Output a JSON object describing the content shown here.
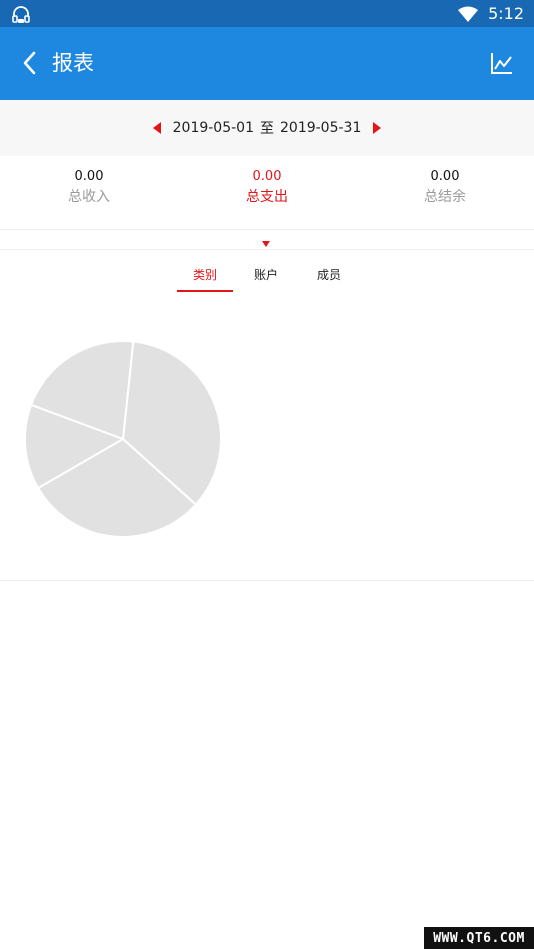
{
  "status_bar": {
    "time": "5:12",
    "left_icon": "notification-headset-icon",
    "wifi_icon": "wifi-icon",
    "color": "#1868b3"
  },
  "app_bar": {
    "title": "报表",
    "back_icon": "chevron-left-icon",
    "chart_icon": "line-chart-icon",
    "color": "#1e88e0"
  },
  "date_bar": {
    "start": "2019-05-01",
    "separator": "至",
    "end": "2019-05-31",
    "prev_icon": "triangle-left-icon",
    "next_icon": "triangle-right-icon"
  },
  "summary": [
    {
      "value": "0.00",
      "label": "总收入",
      "active": false
    },
    {
      "value": "0.00",
      "label": "总支出",
      "active": true
    },
    {
      "value": "0.00",
      "label": "总结余",
      "active": false
    }
  ],
  "tabs": [
    {
      "label": "类别",
      "active": true
    },
    {
      "label": "账户",
      "active": false
    },
    {
      "label": "成员",
      "active": false
    }
  ],
  "colors": {
    "accent": "#e0161a",
    "muted_text": "#9a9a9a",
    "pie_fill": "#e1e1e1"
  },
  "chart_data": {
    "type": "pie",
    "values": [
      35,
      30,
      14,
      21
    ]
  },
  "watermark": "WWW.QT6.COM"
}
